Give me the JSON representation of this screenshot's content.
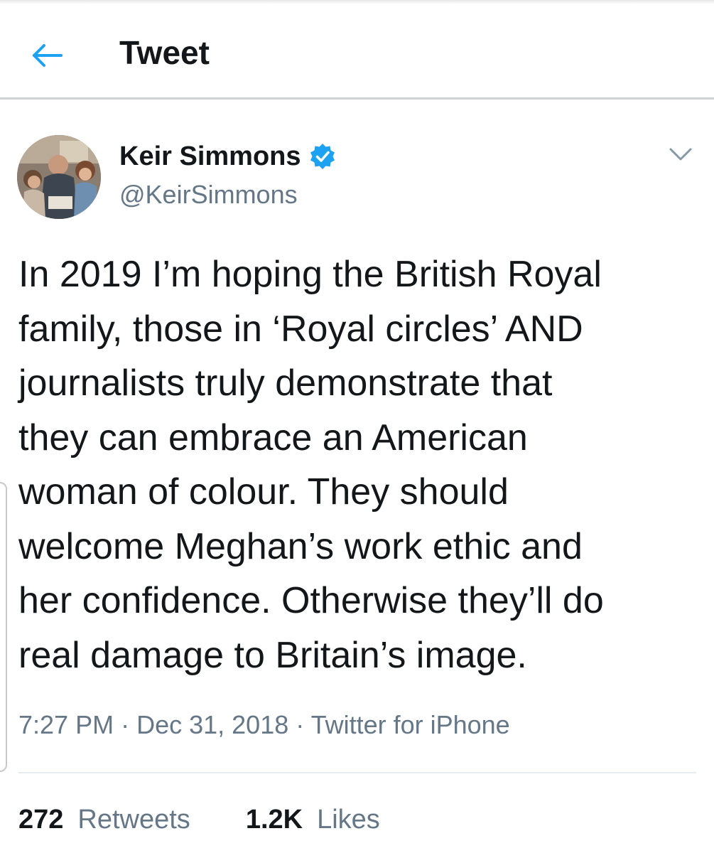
{
  "header": {
    "back_icon": "arrow-left-icon",
    "title": "Tweet",
    "accent_color": "#1da1f2"
  },
  "tweet": {
    "author": {
      "name": "Keir Simmons",
      "handle": "@KeirSimmons",
      "verified": true,
      "verified_icon": "verified-badge-icon"
    },
    "menu_icon": "chevron-down-icon",
    "text": "In 2019 I’m hoping the British Royal\nfamily, those in ‘Royal circles’ AND\njournalists truly demonstrate that\nthey can embrace an American\nwoman of colour. They should\nwelcome Meghan’s work ethic and\nher confidence. Otherwise they’ll do\nreal damage to Britain’s image.",
    "meta": {
      "time": "7:27 PM",
      "separator": " · ",
      "date": "Dec 31, 2018",
      "source": "Twitter for iPhone"
    },
    "stats": {
      "retweets_count": "272",
      "retweets_label": "Retweets",
      "likes_count": "1.2K",
      "likes_label": "Likes"
    }
  }
}
